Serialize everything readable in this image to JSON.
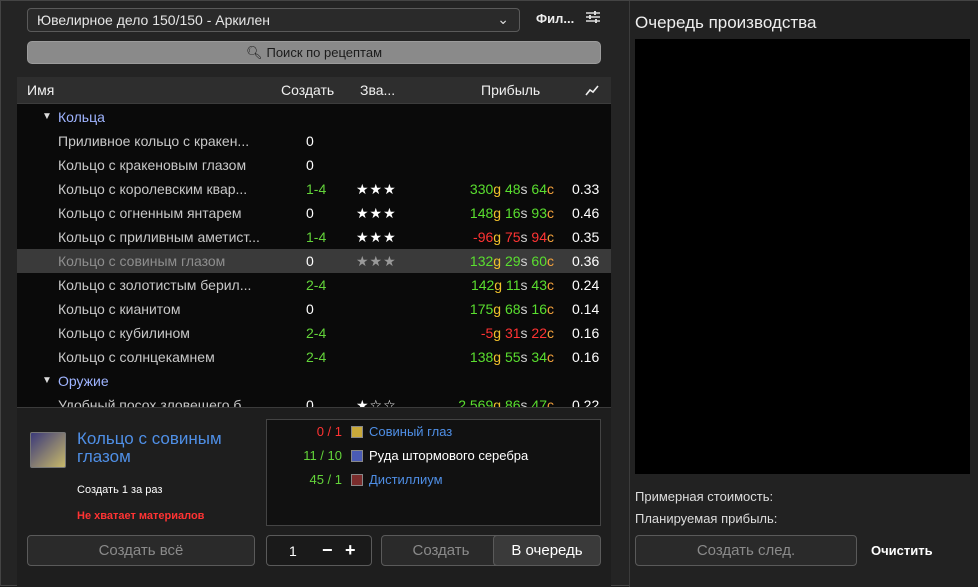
{
  "profession_select": "Ювелирное дело 150/150 - Аркилен",
  "filter_label": "Фил...",
  "search_placeholder": "Поиск по рецептам",
  "columns": {
    "name": "Имя",
    "create": "Создать",
    "rank": "Зва...",
    "profit": "Прибыль"
  },
  "categories": [
    "Кольца",
    "Оружие"
  ],
  "recipes": [
    {
      "name": "Приливное кольцо с кракен...",
      "count": "0",
      "stars": 0,
      "profit": [],
      "ratio": "",
      "selected": false
    },
    {
      "name": "Кольцо с кракеновым глазом",
      "count": "0",
      "stars": 0,
      "profit": [],
      "ratio": "",
      "selected": false
    },
    {
      "name": "Кольцо с королевским квар...",
      "count": "1-4",
      "stars": 3,
      "profit": [
        [
          "330",
          "g"
        ],
        [
          "48",
          "s"
        ],
        [
          "64",
          "c"
        ]
      ],
      "neg": false,
      "ratio": "0.33",
      "selected": false
    },
    {
      "name": "Кольцо с огненным янтарем",
      "count": "0",
      "stars": 3,
      "profit": [
        [
          "148",
          "g"
        ],
        [
          "16",
          "s"
        ],
        [
          "93",
          "c"
        ]
      ],
      "neg": false,
      "ratio": "0.46",
      "selected": false
    },
    {
      "name": "Кольцо с приливным аметист...",
      "count": "1-4",
      "stars": 3,
      "profit": [
        [
          "-96",
          "g"
        ],
        [
          "75",
          "s"
        ],
        [
          "94",
          "c"
        ]
      ],
      "neg": true,
      "ratio": "0.35",
      "selected": false
    },
    {
      "name": "Кольцо с совиным глазом",
      "count": "0",
      "stars": 3,
      "profit": [
        [
          "132",
          "g"
        ],
        [
          "29",
          "s"
        ],
        [
          "60",
          "c"
        ]
      ],
      "neg": false,
      "ratio": "0.36",
      "selected": true
    },
    {
      "name": "Кольцо с золотистым берил...",
      "count": "2-4",
      "stars": 0,
      "profit": [
        [
          "142",
          "g"
        ],
        [
          "11",
          "s"
        ],
        [
          "43",
          "c"
        ]
      ],
      "neg": false,
      "ratio": "0.24",
      "selected": false
    },
    {
      "name": "Кольцо с кианитом",
      "count": "0",
      "stars": 0,
      "profit": [
        [
          "175",
          "g"
        ],
        [
          "68",
          "s"
        ],
        [
          "16",
          "c"
        ]
      ],
      "neg": false,
      "ratio": "0.14",
      "selected": false
    },
    {
      "name": "Кольцо с кубилином",
      "count": "2-4",
      "stars": 0,
      "profit": [
        [
          "-5",
          "g"
        ],
        [
          "31",
          "s"
        ],
        [
          "22",
          "c"
        ]
      ],
      "neg": true,
      "ratio": "0.16",
      "selected": false
    },
    {
      "name": "Кольцо с солнцекамнем",
      "count": "2-4",
      "stars": 0,
      "profit": [
        [
          "138",
          "g"
        ],
        [
          "55",
          "s"
        ],
        [
          "34",
          "c"
        ]
      ],
      "neg": false,
      "ratio": "0.16",
      "selected": false
    },
    {
      "name": "Удобный посох зловещего б...",
      "count": "0",
      "stars": 1,
      "profit": [
        [
          "2,569",
          "g"
        ],
        [
          "86",
          "s"
        ],
        [
          "47",
          "c"
        ]
      ],
      "neg": false,
      "ratio": "0.22",
      "selected": false
    }
  ],
  "detail": {
    "title": "Кольцо с совиным глазом",
    "create_per": "Создать 1 за раз",
    "warning": "Не хватает материалов"
  },
  "reagents": [
    {
      "qty": "0 / 1",
      "name": "Совиный глаз",
      "missing": true,
      "color": "#4f8fe6"
    },
    {
      "qty": "11 / 10",
      "name": "Руда штормового серебра",
      "missing": false,
      "color": "#ffffff"
    },
    {
      "qty": "45 / 1",
      "name": "Дистиллиум",
      "missing": false,
      "color": "#4f8fe6"
    }
  ],
  "buttons": {
    "create_all": "Создать всё",
    "quantity": "1",
    "create": "Создать",
    "queue": "В очередь",
    "create_next": "Создать след.",
    "clear": "Очистить"
  },
  "queue": {
    "title": "Очередь производства",
    "est_cost": "Примерная стоимость:",
    "planned_profit": "Планируемая прибыль:"
  }
}
